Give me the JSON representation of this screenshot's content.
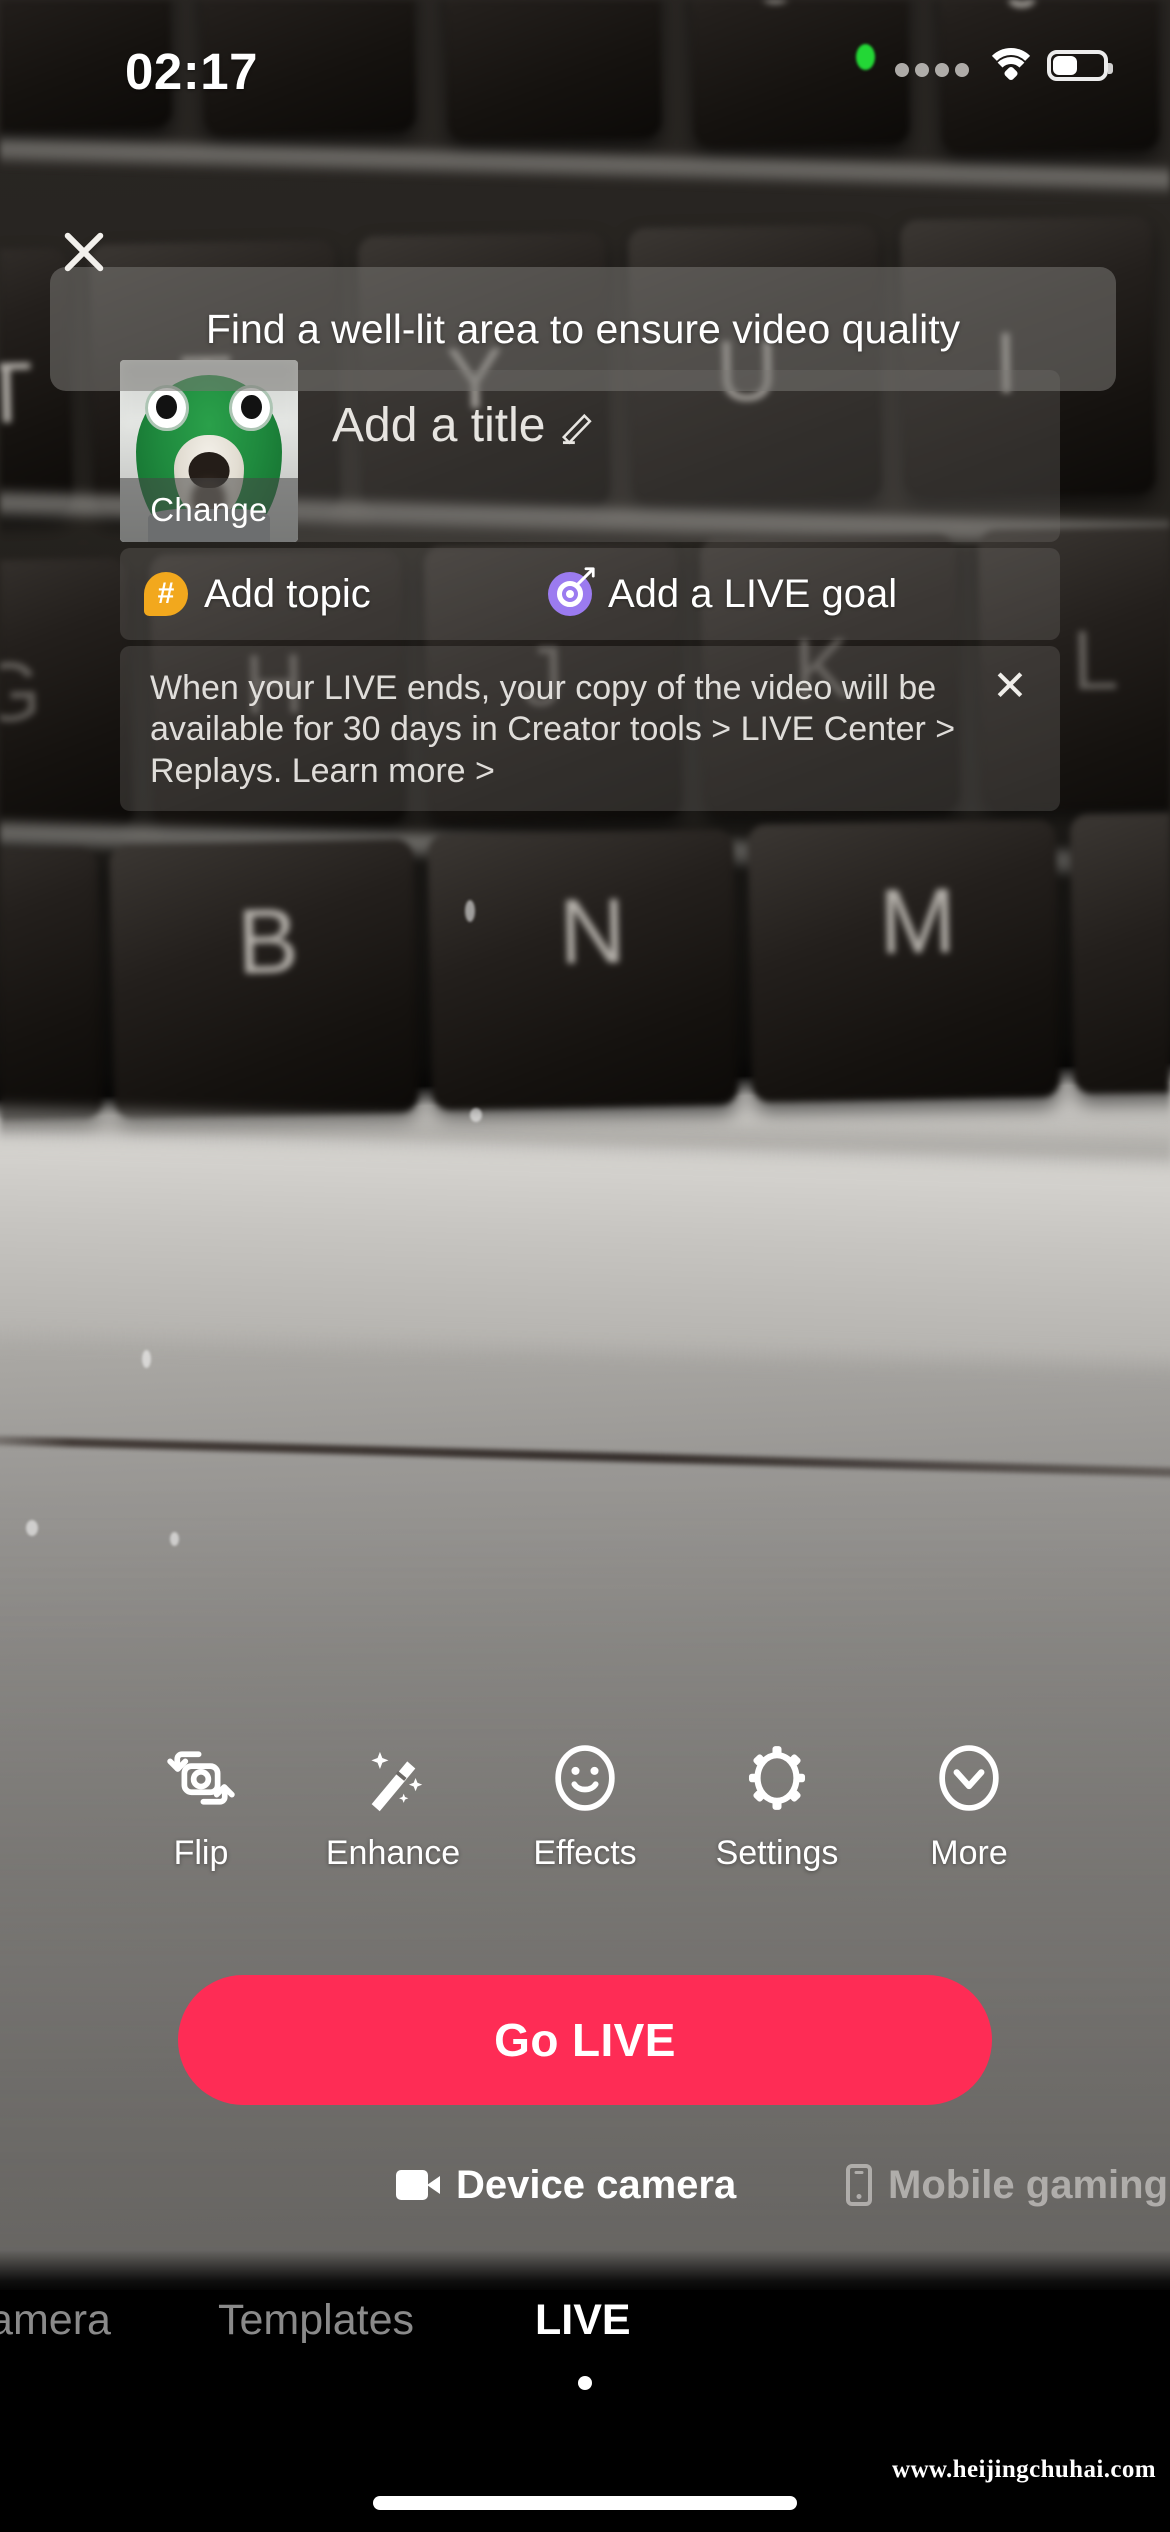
{
  "status_bar": {
    "time": "02:17",
    "wifi_icon": "wifi-icon",
    "battery_icon": "battery-icon",
    "battery_level_pct": 45,
    "signal_icon": "signal-dots-icon",
    "recording_indicator": "green-recording-dot"
  },
  "overlay": {
    "close_icon": "close-x-icon",
    "tip_banner": "Find a well-lit area to ensure video quality"
  },
  "setup": {
    "thumbnail": {
      "change_label": "Change",
      "alt": "dog-in-green-frog-hat-thumbnail"
    },
    "title_placeholder": "Add a title",
    "edit_icon": "pencil-edit-icon",
    "topic": {
      "icon": "hashtag-bubble-icon",
      "icon_color": "#F2A81D",
      "label": "Add topic"
    },
    "goal": {
      "icon": "target-dart-icon",
      "icon_color": "#9B7BF0",
      "label": "Add a LIVE goal"
    },
    "notice": {
      "text": "When your LIVE ends, your copy of the video will be available for 30 days in Creator tools > LIVE Center > Replays.  Learn more >",
      "close_icon": "notice-close-x-icon"
    }
  },
  "toolbar": {
    "items": [
      {
        "label": "Flip",
        "icon": "flip-camera-icon"
      },
      {
        "label": "Enhance",
        "icon": "magic-wand-icon"
      },
      {
        "label": "Effects",
        "icon": "smiley-face-icon"
      },
      {
        "label": "Settings",
        "icon": "gear-icon"
      },
      {
        "label": "More",
        "icon": "chevron-down-circle-icon"
      }
    ]
  },
  "go_live": {
    "label": "Go LIVE",
    "color": "#FE2C55"
  },
  "modes": {
    "items": [
      {
        "label": "Device camera",
        "icon": "video-camera-icon",
        "selected": true
      },
      {
        "label": "Mobile gaming",
        "icon": "mobile-phone-icon",
        "selected": false
      }
    ]
  },
  "tab_bar": {
    "items": [
      {
        "label": "Camera",
        "active": false
      },
      {
        "label": "Templates",
        "active": false
      },
      {
        "label": "LIVE",
        "active": true
      }
    ]
  },
  "watermark": "www.heijingchuhai.com"
}
